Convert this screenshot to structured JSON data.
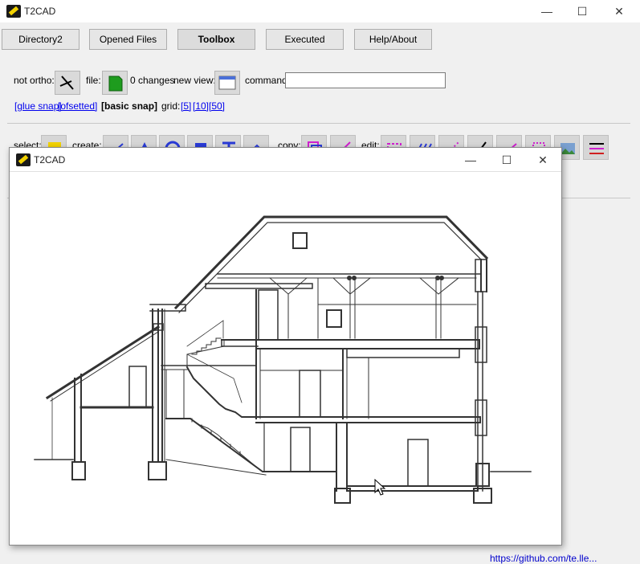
{
  "app": {
    "title": "T2CAD"
  },
  "window_controls": {
    "minimize": "—",
    "maximize": "☐",
    "close": "✕"
  },
  "nav": {
    "tabs": [
      {
        "label": "Directory2"
      },
      {
        "label": "Opened Files"
      },
      {
        "label": "Toolbox",
        "active": true
      },
      {
        "label": "Executed"
      },
      {
        "label": "Help/About"
      }
    ]
  },
  "toolbar": {
    "ortho_label": "not ortho:",
    "file_label": "file:",
    "changes_text": "0 changes",
    "new_view_label": "new view:",
    "command_label": "command:",
    "command_value": ""
  },
  "snap": {
    "glue_snap": "[glue snap]",
    "ofsetted": "[ofsetted]",
    "basic_snap": "[basic snap]",
    "grid_label": "grid:",
    "grid_5": "[5]",
    "grid_10": "[10]",
    "grid_50": "[50]"
  },
  "tools": {
    "select_label": "select:",
    "create_label": "create:",
    "copy_label": "copy:",
    "edit_label": "edit:"
  },
  "background_partial_text": "https://github.com/te.lle...",
  "child_window": {
    "title": "T2CAD"
  }
}
